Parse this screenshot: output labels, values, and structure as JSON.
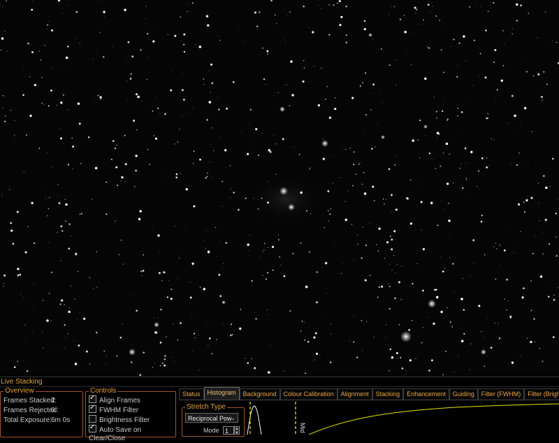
{
  "panel": {
    "title": "Live Stacking"
  },
  "overview": {
    "legend": "Overview",
    "rows": [
      {
        "label": "Frames Stacked:",
        "value": "2"
      },
      {
        "label": "Frames Rejected:",
        "value": "0"
      },
      {
        "label": "Total Exposure:",
        "value": "6m 0s"
      }
    ]
  },
  "controls": {
    "legend": "Controls",
    "items": [
      {
        "label": "Align Frames",
        "checked": true
      },
      {
        "label": "FWHM Filter",
        "checked": true
      },
      {
        "label": "Brightness Filter",
        "checked": false
      },
      {
        "label": "Auto Save on Clear/Close",
        "checked": true
      }
    ]
  },
  "tabs": [
    {
      "label": "Status",
      "active": false
    },
    {
      "label": "Histogram",
      "active": true
    },
    {
      "label": "Background",
      "active": false
    },
    {
      "label": "Colour Calibration",
      "active": false
    },
    {
      "label": "Alignment",
      "active": false
    },
    {
      "label": "Stacking",
      "active": false
    },
    {
      "label": "Enhancement",
      "active": false
    },
    {
      "label": "Guiding",
      "active": false
    },
    {
      "label": "Filter (FWHM)",
      "active": false
    },
    {
      "label": "Filter (Brightness)",
      "active": false
    }
  ],
  "histogram_tab": {
    "stretch_legend": "Stretch Type",
    "stretch_value": "Reciprocal Pow",
    "mode_label": "Mode",
    "mode_value": "1",
    "mid_label": "Mid",
    "colors": {
      "histogram_curve": "#ffffff",
      "marker": "#e6e600",
      "stretch_curve": "#e6e600"
    }
  },
  "colors": {
    "accent": "#e8a33a",
    "groupbox_border": "#a0522d",
    "background": "#000000"
  }
}
